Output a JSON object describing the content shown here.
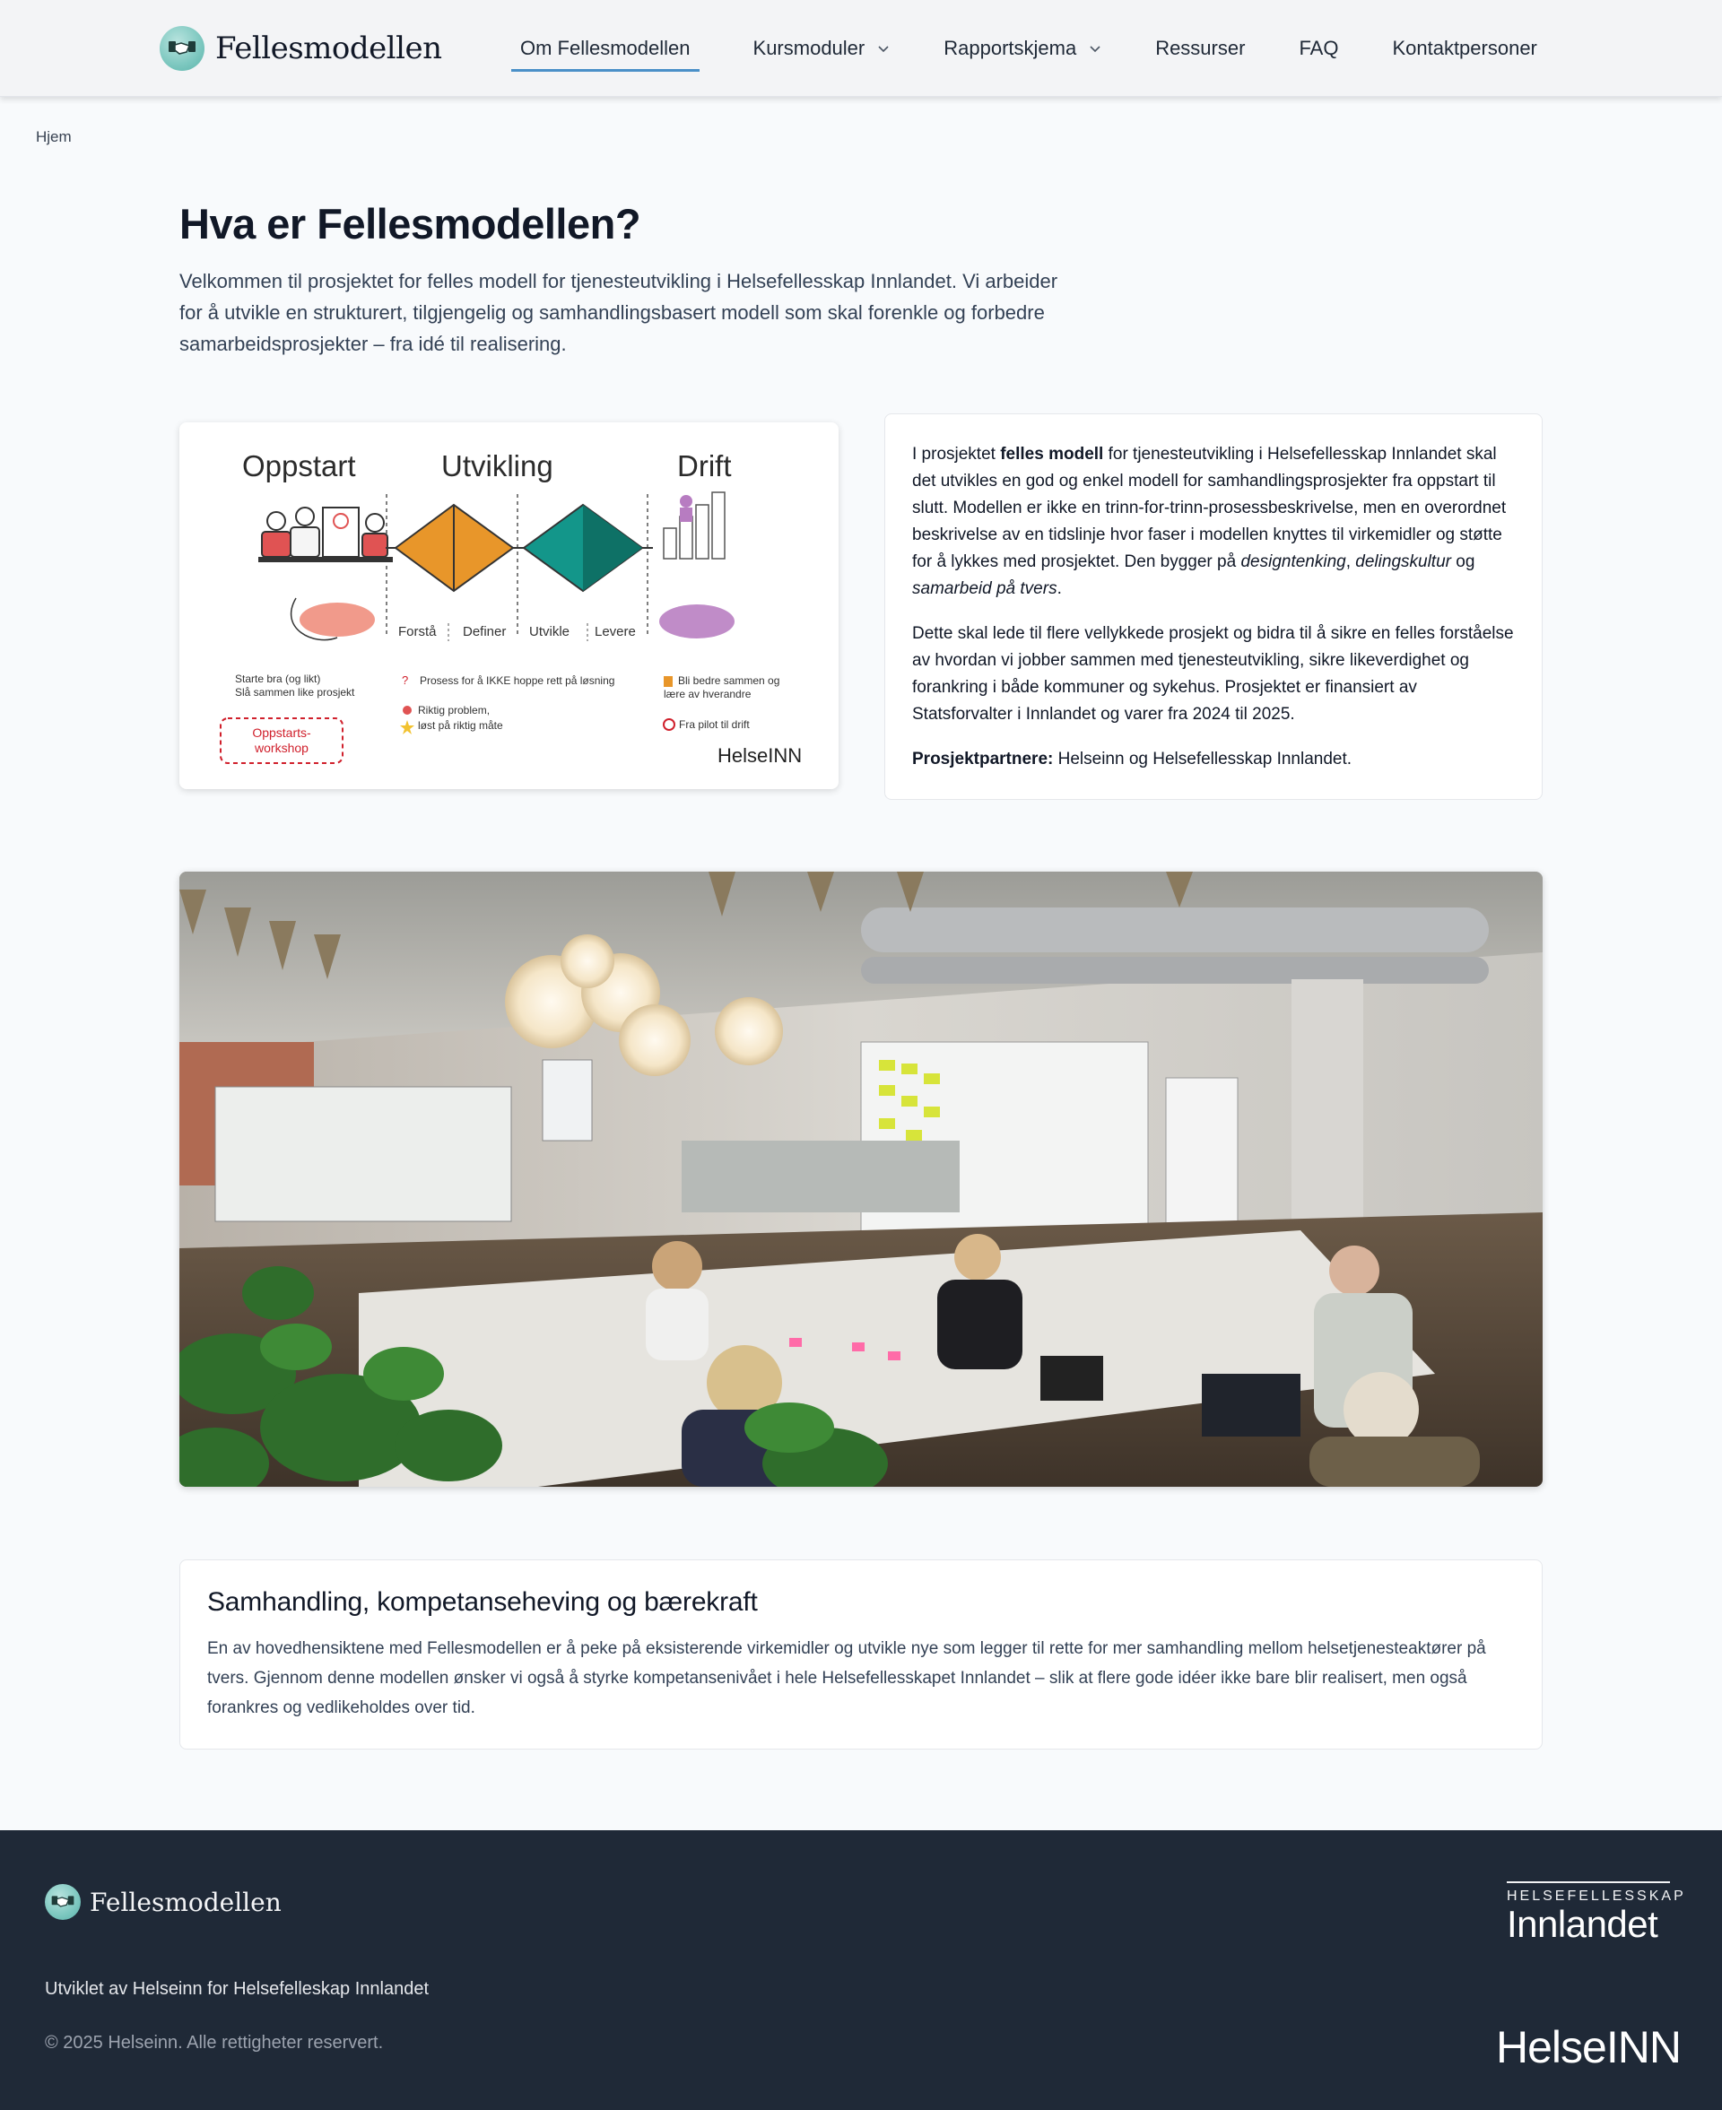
{
  "header": {
    "brand": "Fellesmodellen",
    "nav": [
      {
        "label": "Om Fellesmodellen",
        "active": true,
        "dropdown": false
      },
      {
        "label": "Kursmoduler",
        "active": false,
        "dropdown": true
      },
      {
        "label": "Rapportskjema",
        "active": false,
        "dropdown": true
      },
      {
        "label": "Ressurser",
        "active": false,
        "dropdown": false
      },
      {
        "label": "FAQ",
        "active": false,
        "dropdown": false
      },
      {
        "label": "Kontaktpersoner",
        "active": false,
        "dropdown": false
      }
    ]
  },
  "breadcrumb": "Hjem",
  "hero": {
    "title": "Hva er Fellesmodellen?",
    "intro": "Velkommen til prosjektet for felles modell for tjenesteutvikling i Helsefellesskap Innlandet. Vi arbeider for å utvikle en strukturert, tilgjengelig og samhandlingsbasert modell som skal forenkle og forbedre samarbeidsprosjekter – fra idé til realisering."
  },
  "model_figure": {
    "phases": [
      "Oppstart",
      "Utvikling",
      "Drift"
    ],
    "steps": [
      "Forstå",
      "Definer",
      "Utvikle",
      "Levere"
    ],
    "notes": {
      "start1": "Starte bra (og likt)",
      "start2": "Slå sammen like prosjekt",
      "workshop1": "Oppstarts-",
      "workshop2": "workshop",
      "dev1": "Prosess for å IKKE hoppe rett på løsning",
      "dev2": "Riktig problem,",
      "dev3": "løst på riktig måte",
      "drift1": "Bli bedre sammen og",
      "drift2": "lære av hverandre",
      "drift3": "Fra pilot til drift"
    },
    "logo": "HelseINN",
    "colors": {
      "orange": "#e8962a",
      "teal": "#13968a",
      "salmon": "#f19a8b",
      "purple": "#c08cc8"
    }
  },
  "text_card": {
    "p1_a": "I prosjektet ",
    "p1_bold": "felles modell",
    "p1_b": " for tjenesteutvikling i Helsefellesskap Innlandet skal det utvikles en god og enkel modell for samhandlingsprosjekter fra oppstart til slutt. Modellen er ikke en trinn-for-trinn-prosessbeskrivelse, men en overordnet beskrivelse av en tidslinje hvor faser i modellen knyttes til virkemidler og støtte for å lykkes med prosjektet. Den bygger på ",
    "p1_i1": "designtenking",
    "p1_sep1": ", ",
    "p1_i2": "delingskultur",
    "p1_sep2": " og ",
    "p1_i3": "samarbeid på tvers",
    "p1_end": ".",
    "p2": "Dette skal lede til flere vellykkede prosjekt og bidra til å sikre en felles forståelse av hvordan vi jobber sammen med tjenesteutvikling, sikre likeverdighet og forankring i både kommuner og sykehus. Prosjektet er finansiert av Statsforvalter i Innlandet og varer fra 2024 til 2025.",
    "p3_label": "Prosjektpartnere:",
    "p3_text": " Helseinn og Helsefellesskap Innlandet."
  },
  "info_card": {
    "heading": "Samhandling, kompetanseheving og bærekraft",
    "text": "En av hovedhensiktene med Fellesmodellen er å peke på eksisterende virkemidler og utvikle nye som legger til rette for mer samhandling mellom helsetjenesteaktører på tvers. Gjennom denne modellen ønsker vi også å styrke kompetansenivået i hele Helsefellesskapet Innlandet – slik at flere gode idéer ikke bare blir realisert, men også forankres og vedlikeholdes over tid."
  },
  "footer": {
    "brand": "Fellesmodellen",
    "developed_by": "Utviklet av Helseinn for Helsefelleskap Innlandet",
    "copyright": "© 2025 Helseinn. Alle rettigheter reservert.",
    "partner_top": "HELSEFELLESSKAP",
    "partner_bottom": "Innlandet",
    "helseinn": "HelseINN"
  },
  "colors": {
    "accent": "#4a90c8",
    "footer_bg": "#1f2937",
    "page_bg": "#f8fafc"
  }
}
